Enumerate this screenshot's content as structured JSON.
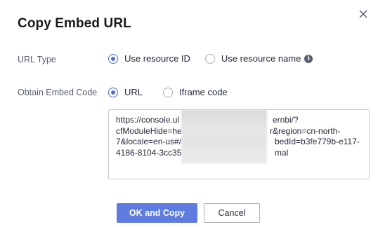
{
  "dialog": {
    "title": "Copy Embed URL"
  },
  "url_type": {
    "label": "URL Type",
    "options": [
      {
        "label": "Use resource ID",
        "checked": true
      },
      {
        "label": "Use resource name",
        "checked": false
      }
    ]
  },
  "embed_code": {
    "label": "Obtain Embed Code",
    "options": [
      {
        "label": "URL",
        "checked": true
      },
      {
        "label": "Iframe code",
        "checked": false
      }
    ],
    "value_lines": [
      "https://console.ul",
      "cfModuleHide=he",
      "7&locale=en-us#/",
      "4186-8104-3cc35"
    ],
    "value_lines_right": [
      "ernbi/?",
      "r&region=cn-north-",
      "bedId=b3fe779b-e117-",
      "mal"
    ]
  },
  "buttons": {
    "ok_label": "OK and Copy",
    "cancel_label": "Cancel"
  },
  "colors": {
    "accent": "#526ecc",
    "primary_button": "#5e7ce0"
  },
  "icons": {
    "close": "close-icon",
    "info": "info-icon"
  }
}
